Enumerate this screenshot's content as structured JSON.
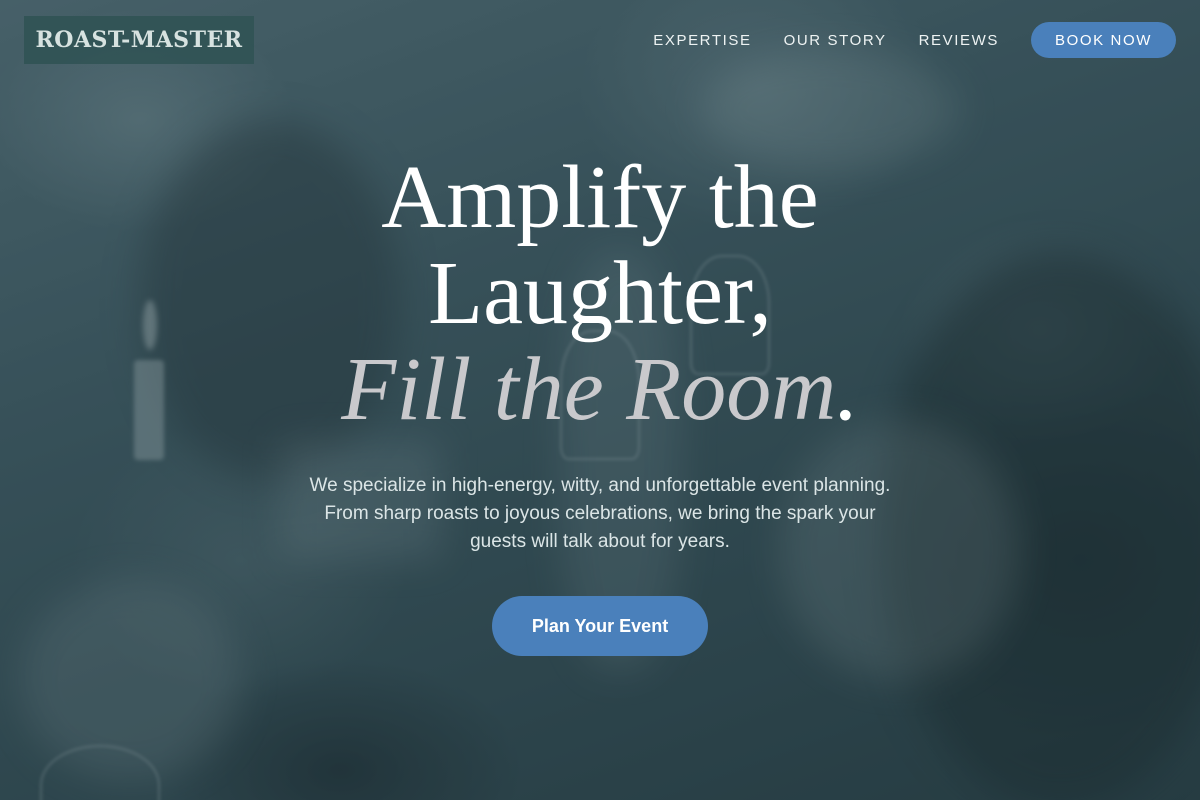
{
  "brand": {
    "logo_text": "ROAST-MASTER"
  },
  "nav": {
    "links": [
      {
        "label": "EXPERTISE"
      },
      {
        "label": "OUR STORY"
      },
      {
        "label": "REVIEWS"
      }
    ],
    "cta_label": "BOOK NOW"
  },
  "hero": {
    "headline_line1": "Amplify the",
    "headline_line2": "Laughter,",
    "headline_accent": "Fill the Room",
    "headline_accent_period": ".",
    "subtext_line1": "We specialize in high-energy, witty, and unforgettable event planning.",
    "subtext_line2": "From sharp roasts to joyous celebrations, we bring the spark your",
    "subtext_line3": "guests will talk about for years.",
    "cta_label": "Plan Your Event"
  },
  "colors": {
    "accent": "#4a80bb",
    "logo_bg": "#2f5254",
    "overlay": "#2b4a52"
  }
}
